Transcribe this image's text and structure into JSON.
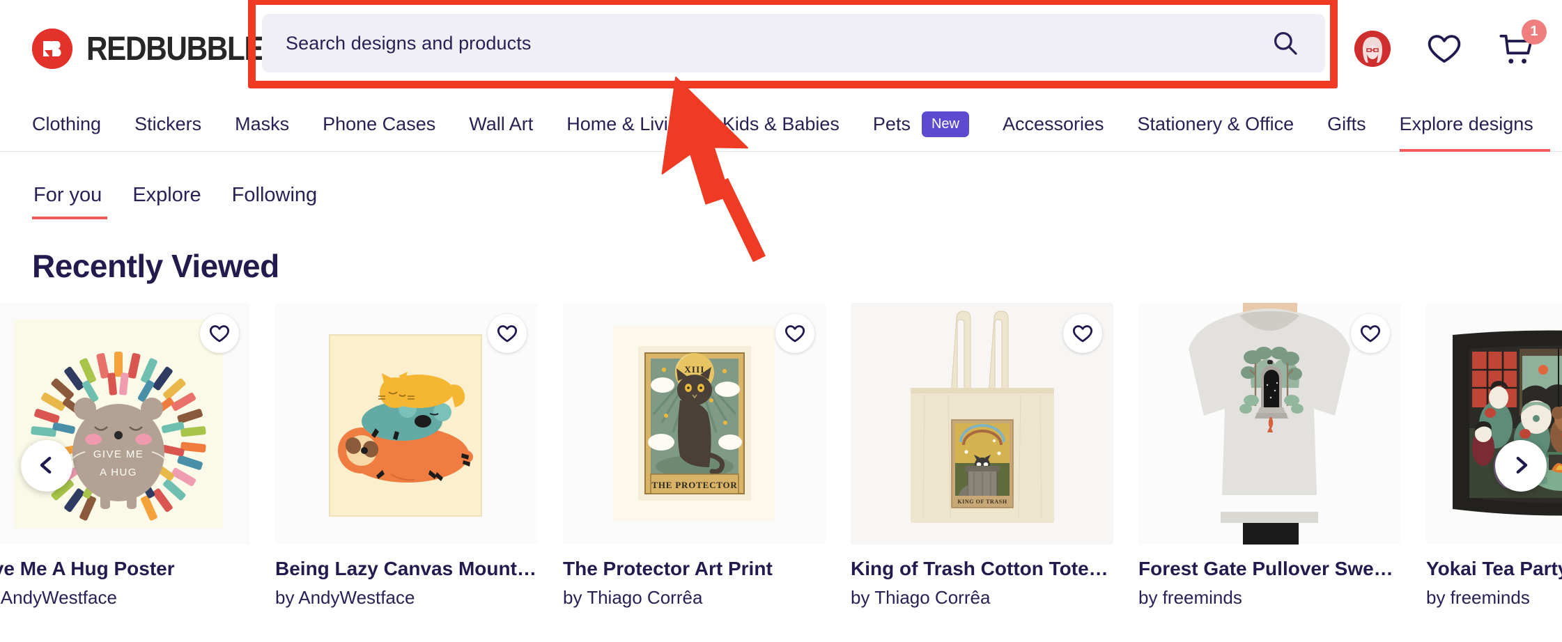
{
  "brand": {
    "name": "REDBUBBLE",
    "logo_mark": "rb-logo-icon",
    "accent_red": "#e3322b",
    "highlight_red": "#ef3b24",
    "navy": "#2b2056"
  },
  "search": {
    "placeholder": "Search designs and products",
    "value": "",
    "icon": "search-icon"
  },
  "header_actions": {
    "account_icon": "avatar-icon",
    "favorites_icon": "heart-icon",
    "cart_icon": "cart-icon",
    "cart_count": "1"
  },
  "nav": {
    "items": [
      {
        "label": "Clothing",
        "active": false
      },
      {
        "label": "Stickers",
        "active": false
      },
      {
        "label": "Masks",
        "active": false
      },
      {
        "label": "Phone Cases",
        "active": false
      },
      {
        "label": "Wall Art",
        "active": false
      },
      {
        "label": "Home & Living",
        "active": false
      },
      {
        "label": "Kids & Babies",
        "active": false
      },
      {
        "label": "Pets",
        "active": false,
        "badge": "New"
      },
      {
        "label": "Accessories",
        "active": false
      },
      {
        "label": "Stationery & Office",
        "active": false
      },
      {
        "label": "Gifts",
        "active": false
      },
      {
        "label": "Explore designs",
        "active": true
      }
    ]
  },
  "subtabs": [
    {
      "label": "For you",
      "active": true
    },
    {
      "label": "Explore",
      "active": false
    },
    {
      "label": "Following",
      "active": false
    }
  ],
  "section": {
    "title": "Recently Viewed"
  },
  "carousel": {
    "prev_icon": "chevron-left-icon",
    "next_icon": "chevron-right-icon",
    "favorite_icon": "heart-outline-icon",
    "cards": [
      {
        "title": "ive Me A Hug Poster",
        "artist": "y AndyWestface",
        "art": "hedgehog-hug-poster"
      },
      {
        "title": "Being Lazy Canvas Mounted P...",
        "artist": "by AndyWestface",
        "art": "being-lazy-canvas"
      },
      {
        "title": "The Protector Art Print",
        "artist": "by Thiago Corrêa",
        "art": "protector-tarot-print"
      },
      {
        "title": "King of Trash Cotton Tote Bag",
        "artist": "by Thiago Corrêa",
        "art": "king-of-trash-tote"
      },
      {
        "title": "Forest Gate Pullover Sweatshirt",
        "artist": "by freeminds",
        "art": "forest-gate-sweatshirt"
      },
      {
        "title": "Yokai Tea Party Tapestry",
        "artist": "by freeminds",
        "art": "yokai-tea-party-tapestry"
      }
    ]
  },
  "artwork_text": {
    "hedgehog_line1": "GIVE ME",
    "hedgehog_line2": "A HUG",
    "tarot_numeral": "XIII",
    "tarot_name": "THE PROTECTOR",
    "tote_name": "KING OF TRASH"
  },
  "annotation": {
    "cursor": "mouse-cursor-arrow",
    "cursor_color": "#ef3b24"
  }
}
